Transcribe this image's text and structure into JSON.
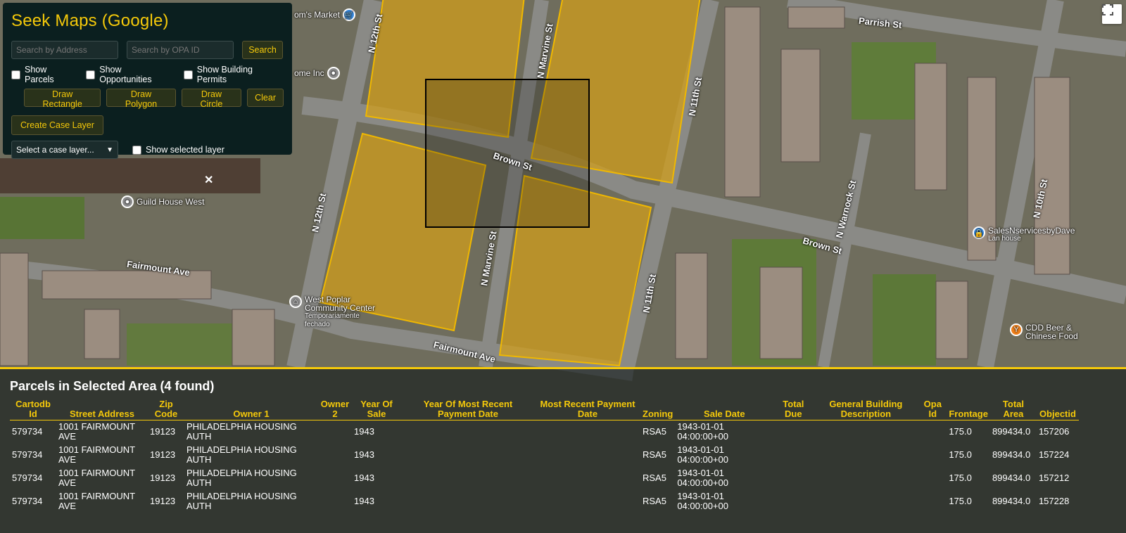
{
  "app": {
    "title": "Seek Maps (Google)"
  },
  "search": {
    "address_placeholder": "Search by Address",
    "opa_placeholder": "Search by OPA ID",
    "search_label": "Search"
  },
  "layers": {
    "parcels_label": "Show Parcels",
    "opportunities_label": "Show Opportunities",
    "permits_label": "Show Building Permits"
  },
  "draw": {
    "rectangle_label": "Draw Rectangle",
    "polygon_label": "Draw Polygon",
    "circle_label": "Draw Circle",
    "clear_label": "Clear"
  },
  "case": {
    "create_label": "Create Case Layer",
    "select_value": "Select a case layer...",
    "show_selected_label": "Show selected layer"
  },
  "map": {
    "streets": {
      "n12_top": "N 12th St",
      "n12_mid": "N 12th St",
      "marvine_top": "N Marvine St",
      "marvine_mid": "N Marvine St",
      "n11_top": "N 11th St",
      "n11_bot": "N 11th St",
      "brown_left": "Brown St",
      "brown_right": "Brown St",
      "fairmount_left": "Fairmount Ave",
      "fairmount_mid": "Fairmount Ave",
      "parrish": "Parrish St",
      "warnock": "N Warnock St",
      "n10": "N 10th St"
    },
    "pois": {
      "guild": "Guild House West",
      "community1": "West Poplar",
      "community2": "Community Center",
      "community3": "Temporariamente",
      "community4": "fechado",
      "sales1": "SalesNservicesbyDave",
      "sales2": "Lan house",
      "cdd1": "CDD Beer &",
      "cdd2": "Chinese Food",
      "market": "om's Market",
      "home": "ome Inc"
    }
  },
  "results": {
    "title": "Parcels in Selected Area (4 found)",
    "columns": [
      "Cartodb Id",
      "Street Address",
      "Zip Code",
      "Owner 1",
      "Owner 2",
      "Year Of Sale",
      "Year Of Most Recent Payment Date",
      "Most Recent Payment Date",
      "Zoning",
      "Sale Date",
      "Total Due",
      "General Building Description",
      "Opa Id",
      "Frontage",
      "Total Area",
      "Objectid"
    ],
    "rows": [
      [
        "579734",
        "1001 FAIRMOUNT AVE",
        "19123",
        "PHILADELPHIA HOUSING AUTH",
        "",
        "1943",
        "",
        "",
        "RSA5",
        "1943-01-01 04:00:00+00",
        "",
        "",
        "",
        "175.0",
        "899434.0",
        "157206"
      ],
      [
        "579734",
        "1001 FAIRMOUNT AVE",
        "19123",
        "PHILADELPHIA HOUSING AUTH",
        "",
        "1943",
        "",
        "",
        "RSA5",
        "1943-01-01 04:00:00+00",
        "",
        "",
        "",
        "175.0",
        "899434.0",
        "157224"
      ],
      [
        "579734",
        "1001 FAIRMOUNT AVE",
        "19123",
        "PHILADELPHIA HOUSING AUTH",
        "",
        "1943",
        "",
        "",
        "RSA5",
        "1943-01-01 04:00:00+00",
        "",
        "",
        "",
        "175.0",
        "899434.0",
        "157212"
      ],
      [
        "579734",
        "1001 FAIRMOUNT AVE",
        "19123",
        "PHILADELPHIA HOUSING AUTH",
        "",
        "1943",
        "",
        "",
        "RSA5",
        "1943-01-01 04:00:00+00",
        "",
        "",
        "",
        "175.0",
        "899434.0",
        "157228"
      ]
    ]
  },
  "colors": {
    "accent": "#f5c90a",
    "panel_bg": "#0b1f1f",
    "parcel_fill": "#d4a017"
  }
}
